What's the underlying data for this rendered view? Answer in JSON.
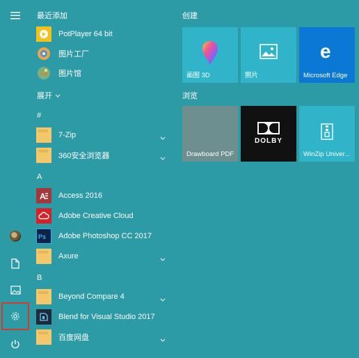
{
  "left_rail": {
    "buttons": [
      {
        "name": "hamburger-menu-icon"
      },
      {
        "name": "user-avatar"
      },
      {
        "name": "document-icon"
      },
      {
        "name": "pictures-icon"
      },
      {
        "name": "settings-icon"
      },
      {
        "name": "power-icon"
      }
    ],
    "highlight_color": "#d23c2e"
  },
  "app_list": {
    "recent_header": "最近添加",
    "recent": [
      {
        "label": "PotPlayer 64 bit",
        "icon": "potplayer-icon"
      },
      {
        "label": "图片工厂",
        "icon": "picture-factory-icon"
      },
      {
        "label": "图片馆",
        "icon": "picture-gallery-icon"
      }
    ],
    "expand_label": "展开",
    "groups": [
      {
        "letter": "#",
        "items": [
          {
            "label": "7-Zip",
            "icon": "folder-icon",
            "expandable": true
          },
          {
            "label": "360安全浏览器",
            "icon": "folder-icon",
            "expandable": true
          }
        ]
      },
      {
        "letter": "A",
        "items": [
          {
            "label": "Access 2016",
            "icon": "access-icon",
            "expandable": false
          },
          {
            "label": "Adobe Creative Cloud",
            "icon": "creative-cloud-icon",
            "expandable": false
          },
          {
            "label": "Adobe Photoshop CC 2017",
            "icon": "photoshop-icon",
            "expandable": false
          },
          {
            "label": "Axure",
            "icon": "folder-icon",
            "expandable": true
          }
        ]
      },
      {
        "letter": "B",
        "items": [
          {
            "label": "Beyond Compare 4",
            "icon": "folder-icon",
            "expandable": true
          },
          {
            "label": "Blend for Visual Studio 2017",
            "icon": "blend-icon",
            "expandable": false
          },
          {
            "label": "百度网盘",
            "icon": "folder-icon",
            "expandable": true
          }
        ]
      }
    ]
  },
  "tiles": {
    "create_header": "创建",
    "browse_header": "浏览",
    "create": [
      {
        "label": "画图 3D",
        "icon": "paint3d-icon",
        "color": "#2fb4c9"
      },
      {
        "label": "照片",
        "icon": "photos-icon",
        "color": "#2fb4c9"
      },
      {
        "label": "Microsoft Edge",
        "icon": "edge-icon",
        "color": "#0a78d4"
      }
    ],
    "browse": [
      {
        "label": "Drawboard PDF",
        "icon": "",
        "color": "#6d8f8f"
      },
      {
        "label": "",
        "icon": "dolby-icon",
        "color": "#111111",
        "logo_text": "DOLBY"
      },
      {
        "label": "WinZip Univer...",
        "icon": "winzip-icon",
        "color": "#2fb4c9"
      }
    ]
  }
}
